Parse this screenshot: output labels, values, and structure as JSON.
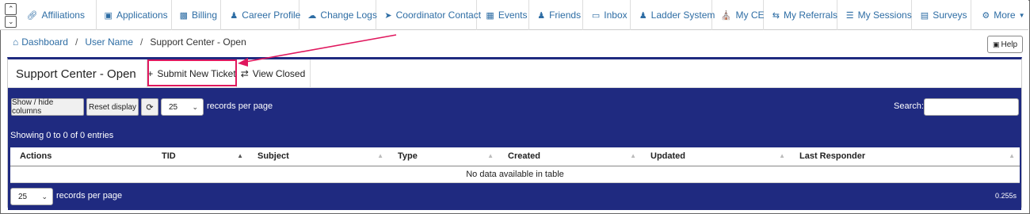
{
  "nav": {
    "items": [
      {
        "label": "Affiliations",
        "icon": "link-icon"
      },
      {
        "label": "Applications",
        "icon": "id-card-icon"
      },
      {
        "label": "Billing",
        "icon": "money-icon"
      },
      {
        "label": "Career Profile",
        "icon": "user-icon"
      },
      {
        "label": "Change Logs",
        "icon": "cloud-icon"
      },
      {
        "label": "Coordinator Contact",
        "icon": "paper-plane-icon"
      },
      {
        "label": "Events",
        "icon": "calendar-icon"
      },
      {
        "label": "Friends",
        "icon": "users-icon"
      },
      {
        "label": "Inbox",
        "icon": "inbox-icon"
      },
      {
        "label": "Ladder System",
        "icon": "user-group-icon"
      },
      {
        "label": "My CE",
        "icon": "bank-icon"
      },
      {
        "label": "My Referrals",
        "icon": "retweet-icon"
      },
      {
        "label": "My Sessions",
        "icon": "list-icon"
      },
      {
        "label": "Surveys",
        "icon": "list-alt-icon"
      }
    ],
    "more_label": "More"
  },
  "breadcrumb": {
    "home": "Dashboard",
    "user": "User Name",
    "current": "Support Center - Open"
  },
  "help_label": "Help",
  "panel": {
    "title": "Support Center - Open",
    "submit_label": "Submit New Ticket",
    "closed_label": "View Closed"
  },
  "toolbar": {
    "show_hide_label": "Show / hide columns",
    "reset_label": "Reset display",
    "page_size": "25",
    "records_per_page": "records per page",
    "search_label": "Search:"
  },
  "info_text": "Showing 0 to 0 of 0 entries",
  "table": {
    "columns": [
      "Actions",
      "TID",
      "Subject",
      "Type",
      "Created",
      "Updated",
      "Last Responder"
    ],
    "empty_text": "No data available in table"
  },
  "footer": {
    "page_size": "25",
    "records_per_page": "records per page",
    "timing": "0.255s"
  },
  "colors": {
    "accent": "#1f2a80",
    "link": "#2e6da4",
    "highlight": "#e0185e"
  }
}
